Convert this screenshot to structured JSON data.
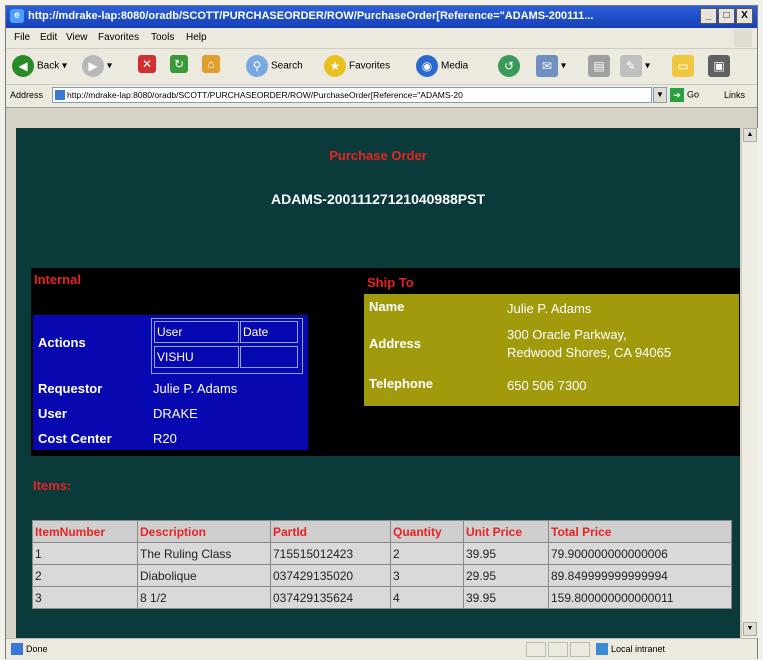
{
  "window": {
    "title": "http://mdrake-lap:8080/oradb/SCOTT/PURCHASEORDER/ROW/PurchaseOrder[Reference=\"ADAMS-200111...",
    "controls": [
      "_",
      "□",
      "X"
    ]
  },
  "menu": [
    "File",
    "Edit",
    "View",
    "Favorites",
    "Tools",
    "Help"
  ],
  "toolbar": {
    "back": "Back",
    "search": "Search",
    "favorites": "Favorites",
    "media": "Media"
  },
  "address": {
    "label": "Address",
    "url": "http://mdrake-lap:8080/oradb/SCOTT/PURCHASEORDER/ROW/PurchaseOrder[Reference=\"ADAMS-20",
    "go": "Go",
    "links": "Links"
  },
  "page": {
    "title": "Purchase Order",
    "reference": "ADAMS-20011127121040988PST"
  },
  "internal": {
    "heading": "Internal",
    "actions_label": "Actions",
    "actions_headers": [
      "User",
      "Date"
    ],
    "actions_user": "VISHU",
    "actions_date": "",
    "requestor_label": "Requestor",
    "requestor": "Julie P. Adams",
    "user_label": "User",
    "user": "DRAKE",
    "cost_center_label": "Cost Center",
    "cost_center": "R20"
  },
  "ship_to": {
    "heading": "Ship To",
    "name_label": "Name",
    "name": "Julie P. Adams",
    "address_label": "Address",
    "address_line1": "300 Oracle Parkway,",
    "address_line2": "Redwood Shores, CA 94065",
    "telephone_label": "Telephone",
    "telephone": "650 506 7300"
  },
  "items": {
    "heading": "Items:",
    "columns": [
      "ItemNumber",
      "Description",
      "PartId",
      "Quantity",
      "Unit Price",
      "Total Price"
    ],
    "rows": [
      [
        "1",
        "The Ruling Class",
        "715515012423",
        "2",
        "39.95",
        "79.900000000000006"
      ],
      [
        "2",
        "Diabolique",
        "037429135020",
        "3",
        "29.95",
        "89.849999999999994"
      ],
      [
        "3",
        "8 1/2",
        "037429135624",
        "4",
        "39.95",
        "159.800000000000011"
      ]
    ]
  },
  "status": {
    "text": "Done",
    "zone": "Local intranet"
  },
  "colors": {
    "page_bg": "#0b3a3a",
    "heading_red": "#e62424",
    "internal_blue": "#0808b0",
    "ship_olive": "#a09a0c"
  }
}
